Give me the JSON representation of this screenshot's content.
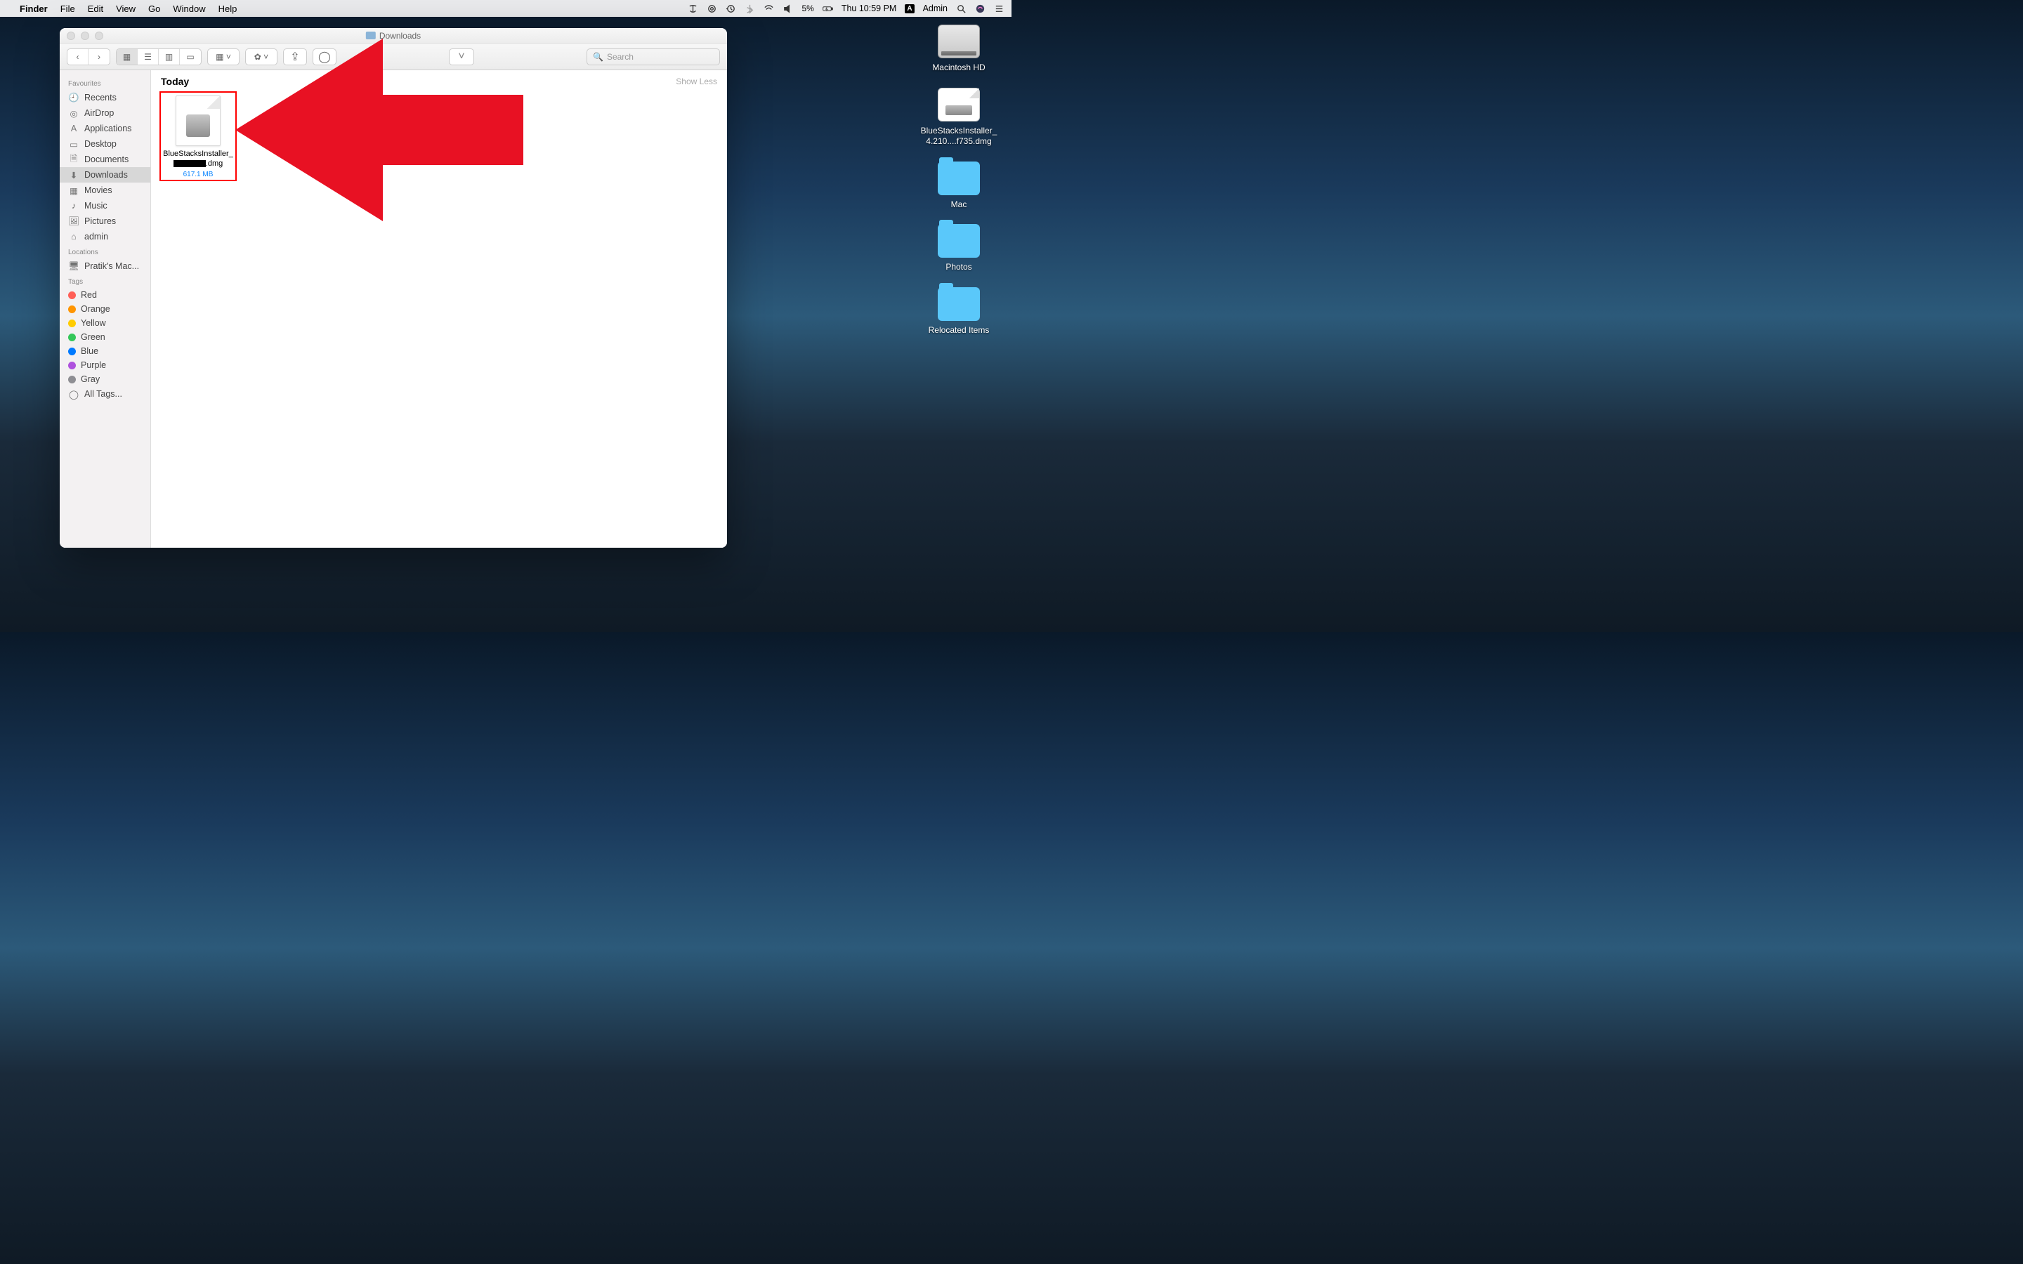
{
  "menubar": {
    "app": "Finder",
    "items": [
      "File",
      "Edit",
      "View",
      "Go",
      "Window",
      "Help"
    ],
    "battery": "5%",
    "time": "Thu 10:59 PM",
    "user_badge": "A",
    "user": "Admin"
  },
  "desktop": {
    "items": [
      {
        "kind": "hd",
        "label": "Macintosh HD"
      },
      {
        "kind": "dmg",
        "label": "BlueStacksInstaller_4.210....f735.dmg"
      },
      {
        "kind": "folder",
        "label": "Mac"
      },
      {
        "kind": "folder",
        "label": "Photos"
      },
      {
        "kind": "folder",
        "label": "Relocated Items"
      }
    ]
  },
  "finder": {
    "title": "Downloads",
    "search_placeholder": "Search",
    "section": "Today",
    "show_less": "Show Less",
    "sidebar": {
      "favourites_header": "Favourites",
      "favourites": [
        "Recents",
        "AirDrop",
        "Applications",
        "Desktop",
        "Documents",
        "Downloads",
        "Movies",
        "Music",
        "Pictures",
        "admin"
      ],
      "selected": "Downloads",
      "locations_header": "Locations",
      "locations": [
        "Pratik's Mac..."
      ],
      "tags_header": "Tags",
      "tags": [
        {
          "label": "Red",
          "color": "#ff5f57"
        },
        {
          "label": "Orange",
          "color": "#ff9500"
        },
        {
          "label": "Yellow",
          "color": "#ffcc00"
        },
        {
          "label": "Green",
          "color": "#34c759"
        },
        {
          "label": "Blue",
          "color": "#007aff"
        },
        {
          "label": "Purple",
          "color": "#af52de"
        },
        {
          "label": "Gray",
          "color": "#8e8e93"
        }
      ],
      "all_tags": "All Tags..."
    },
    "file": {
      "name_prefix": "BlueStacksInstaller_",
      "name_suffix": ".dmg",
      "size": "617.1 MB"
    }
  }
}
